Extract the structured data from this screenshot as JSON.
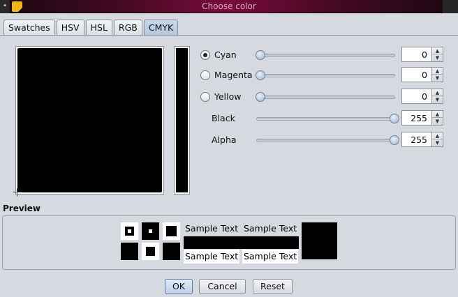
{
  "window": {
    "title": "Choose color",
    "menu_glyph": "•"
  },
  "tabs": [
    {
      "label": "Swatches",
      "active": false
    },
    {
      "label": "HSV",
      "active": false
    },
    {
      "label": "HSL",
      "active": false
    },
    {
      "label": "RGB",
      "active": false
    },
    {
      "label": "CMYK",
      "active": true
    }
  ],
  "channels": [
    {
      "label": "Cyan",
      "has_radio": true,
      "selected": true,
      "value": "0"
    },
    {
      "label": "Magenta",
      "has_radio": true,
      "selected": false,
      "value": "0"
    },
    {
      "label": "Yellow",
      "has_radio": true,
      "selected": false,
      "value": "0"
    },
    {
      "label": "Black",
      "has_radio": false,
      "selected": false,
      "value": "255"
    },
    {
      "label": "Alpha",
      "has_radio": false,
      "selected": false,
      "value": "255"
    }
  ],
  "slider_max": 255,
  "spin_glyphs": {
    "up": "▲",
    "down": "▼"
  },
  "preview": {
    "label": "Preview",
    "sample_text": "Sample Text"
  },
  "buttons": {
    "ok": "OK",
    "cancel": "Cancel",
    "reset": "Reset"
  },
  "colors": {
    "selected_color": "#000000",
    "titlebar_accent": "#7a0c3c",
    "app_icon": "#f2b61c"
  }
}
